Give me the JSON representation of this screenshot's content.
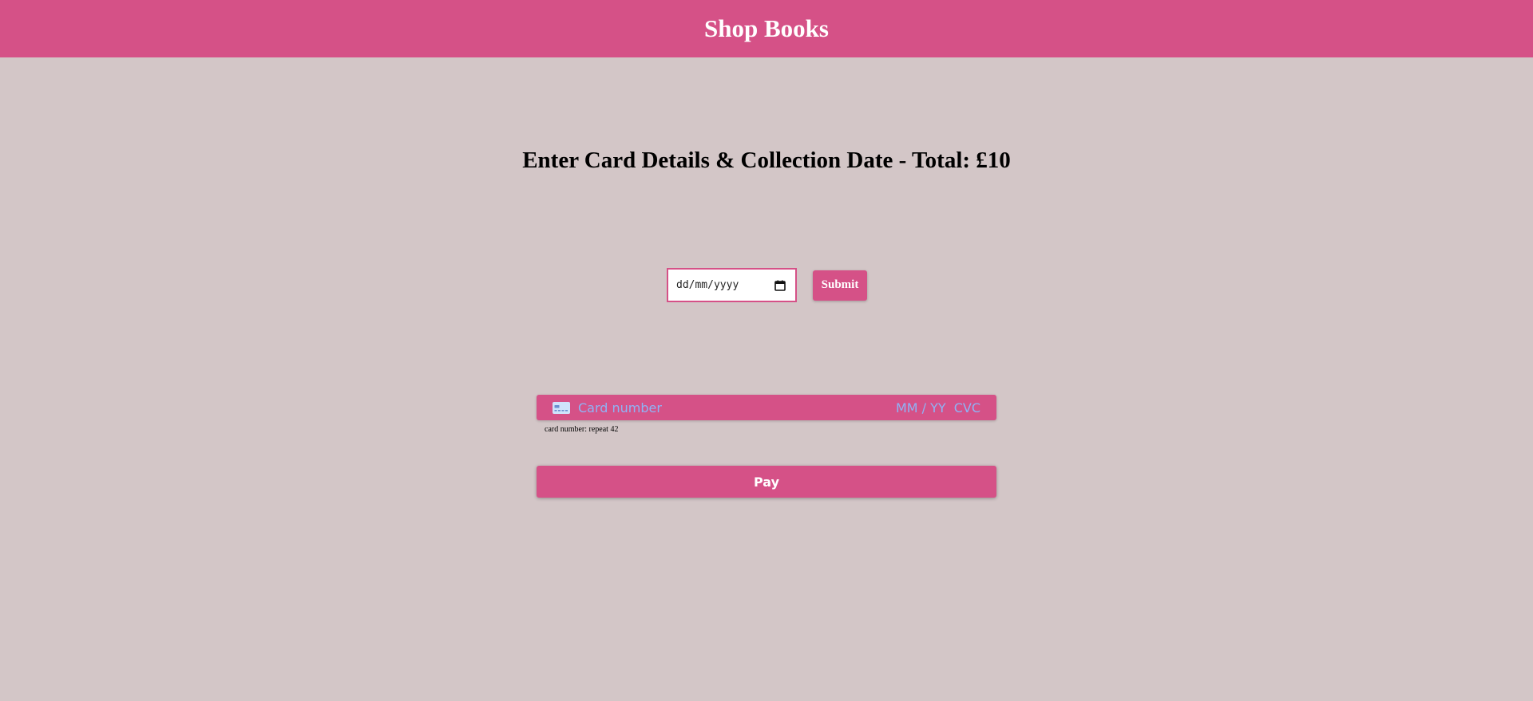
{
  "header": {
    "title": "Shop Books"
  },
  "main": {
    "title": "Enter Card Details & Collection Date - Total: £10"
  },
  "date_form": {
    "date_placeholder": "dd/mm/yyyy",
    "submit_label": "Submit",
    "calendar_icon": "calendar-icon"
  },
  "card_form": {
    "card_icon": "credit-card-icon",
    "card_number_placeholder": "Card number",
    "expiry_placeholder": "MM / YY",
    "cvc_placeholder": "CVC",
    "error_text": "card number: repeat 42",
    "pay_label": "Pay"
  },
  "colors": {
    "brand": "#d55187",
    "background": "#d3c6c7",
    "placeholder": "#8fb3f5"
  }
}
